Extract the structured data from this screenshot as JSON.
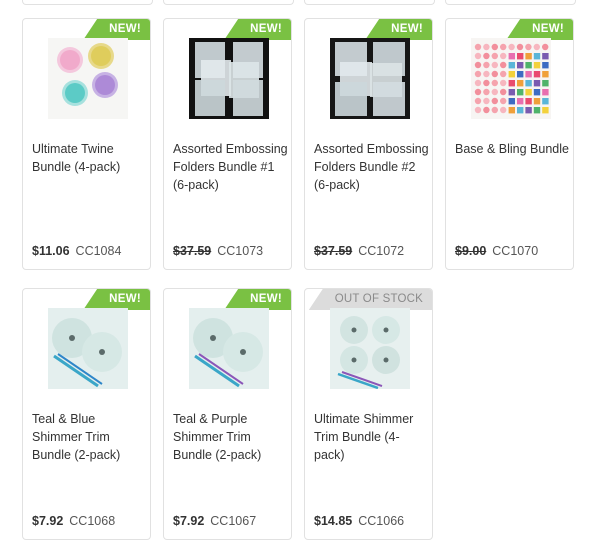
{
  "badges": {
    "new": "NEW!",
    "out_of_stock": "OUT OF STOCK"
  },
  "colors": {
    "new_badge": "#7ac143",
    "out_of_stock_badge": "#dcdcdc",
    "card_border": "#e1e1e1"
  },
  "products": [
    {
      "title": "Ultimate Twine Bundle (4-pack)",
      "price": "$11.06",
      "sku": "CC1084",
      "badge": "NEW!",
      "price_struck": false
    },
    {
      "title": "Assorted Embossing Folders Bundle #1 (6-pack)",
      "price": "$37.59",
      "sku": "CC1073",
      "badge": "NEW!",
      "price_struck": true
    },
    {
      "title": "Assorted Embossing Folders Bundle #2 (6-pack)",
      "price": "$37.59",
      "sku": "CC1072",
      "badge": "NEW!",
      "price_struck": true
    },
    {
      "title": "Base & Bling Bundle",
      "price": "$9.00",
      "sku": "CC1070",
      "badge": "NEW!",
      "price_struck": true
    },
    {
      "title": "Teal & Blue Shimmer Trim Bundle (2-pack)",
      "price": "$7.92",
      "sku": "CC1068",
      "badge": "NEW!",
      "price_struck": false
    },
    {
      "title": "Teal & Purple Shimmer Trim Bundle (2-pack)",
      "price": "$7.92",
      "sku": "CC1067",
      "badge": "NEW!",
      "price_struck": false
    },
    {
      "title": "Ultimate Shimmer Trim Bundle (4-pack)",
      "price": "$14.85",
      "sku": "CC1066",
      "badge": "OUT OF STOCK",
      "price_struck": false
    }
  ]
}
